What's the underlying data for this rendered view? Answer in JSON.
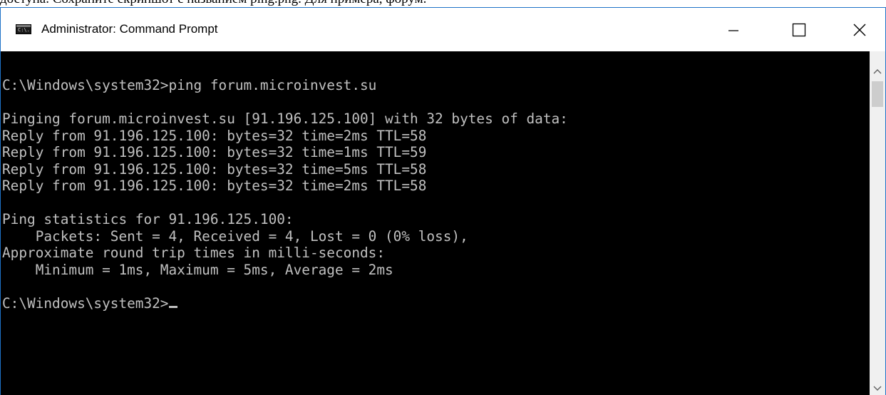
{
  "document": {
    "text": "доступа. Сохраните скриншот с названием ping.png. Для примера, форум."
  },
  "window": {
    "title": "Administrator: Command Prompt",
    "icon": "cmd-icon",
    "icon_glyph": "C:\\.",
    "controls": {
      "minimize": "minimize-icon",
      "maximize": "maximize-icon",
      "close": "close-icon"
    }
  },
  "console": {
    "lines": [
      "C:\\Windows\\system32>ping forum.microinvest.su",
      "",
      "Pinging forum.microinvest.su [91.196.125.100] with 32 bytes of data:",
      "Reply from 91.196.125.100: bytes=32 time=2ms TTL=58",
      "Reply from 91.196.125.100: bytes=32 time=1ms TTL=59",
      "Reply from 91.196.125.100: bytes=32 time=5ms TTL=58",
      "Reply from 91.196.125.100: bytes=32 time=2ms TTL=58",
      "",
      "Ping statistics for 91.196.125.100:",
      "    Packets: Sent = 4, Received = 4, Lost = 0 (0% loss),",
      "Approximate round trip times in milli-seconds:",
      "    Minimum = 1ms, Maximum = 5ms, Average = 2ms",
      "",
      "C:\\Windows\\system32>"
    ],
    "text_color": "#c0c0c0",
    "background": "#000000"
  },
  "colors": {
    "window_border": "#1e72c8",
    "titlebar": "#ffffff",
    "scrollbar": "#f0f0f0"
  }
}
